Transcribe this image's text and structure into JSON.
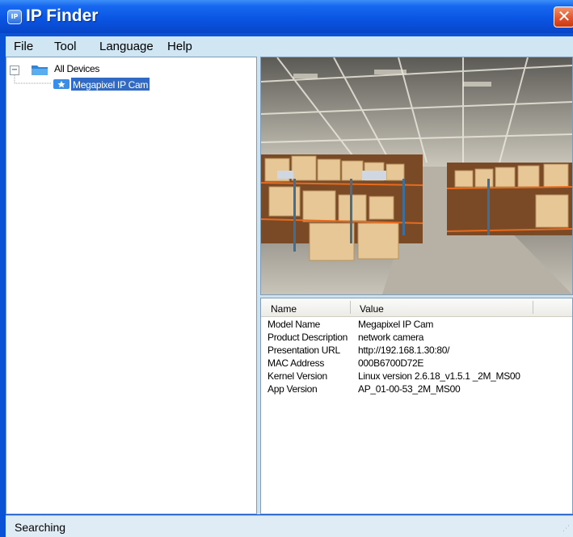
{
  "window": {
    "title": "IP Finder",
    "icon_text": "IP",
    "close_glyph": "✕"
  },
  "menu": [
    "File",
    "Tool",
    "Language",
    "Help"
  ],
  "tree": {
    "expander": "−",
    "root_label": "All Devices",
    "root_icon": "folder-icon",
    "child_label": "Megapixel IP Cam",
    "child_icon": "camera-device-icon"
  },
  "preview": {
    "description_icon": "warehouse-camera-snapshot"
  },
  "details": {
    "columns": [
      "Name",
      "Value"
    ],
    "rows": [
      {
        "name": "Model Name",
        "value": "Megapixel IP Cam"
      },
      {
        "name": "Product Description",
        "value": "network camera"
      },
      {
        "name": "Presentation URL",
        "value": "http://192.168.1.30:80/"
      },
      {
        "name": "MAC Address",
        "value": "000B6700D72E"
      },
      {
        "name": "Kernel Version",
        "value": "Linux version 2.6.18_v1.5.1 _2M_MS00"
      },
      {
        "name": "App Version",
        "value": "AP_01-00-53_2M_MS00"
      }
    ]
  },
  "status": {
    "text": "Searching",
    "grip": "⋰"
  },
  "colors": {
    "title_bar": "#0a56e4",
    "menu_bar": "#d1e6f3",
    "selection": "#316ac5"
  }
}
